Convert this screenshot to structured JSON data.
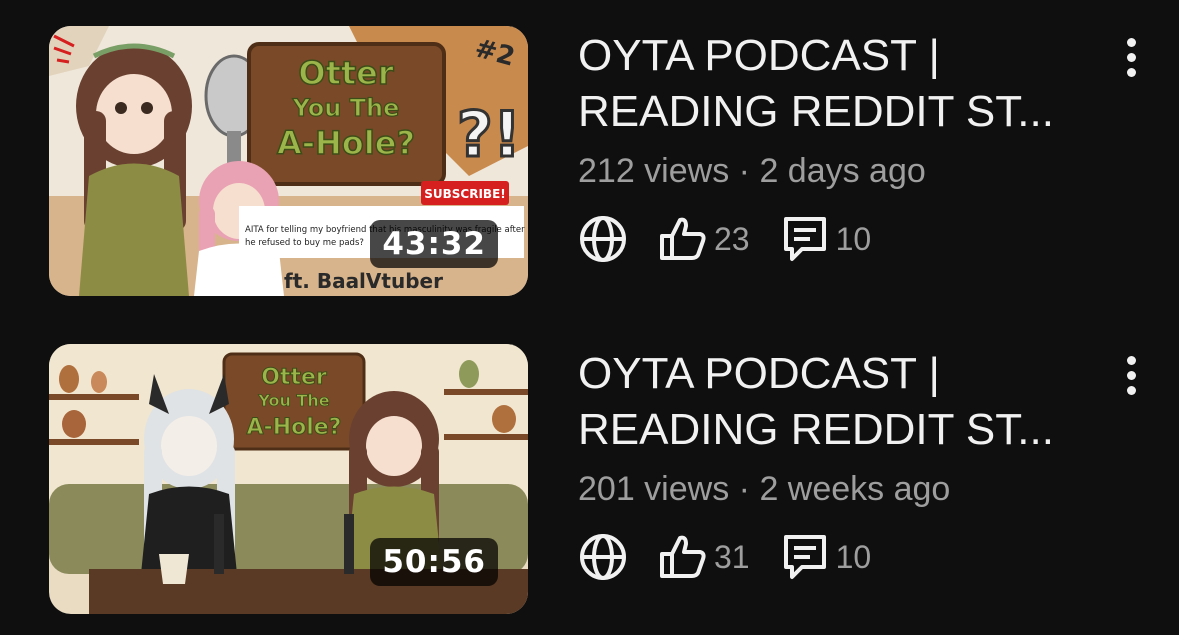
{
  "videos": [
    {
      "title_line1": "OYTA PODCAST |",
      "title_line2": "READING REDDIT ST...",
      "views": "212 views",
      "separator": "·",
      "age": "2 days ago",
      "duration": "43:32",
      "likes": "23",
      "comments": "10",
      "thumbnail": {
        "sign_line1": "Otter",
        "sign_line2": "You The",
        "sign_line3": "A-Hole?",
        "episode": "#2",
        "subscribe": "SUBSCRIBE!",
        "post_text_1": "AITA for telling my boyfriend that his masculinity was fragile after",
        "post_text_2": "he refused to buy me pads?",
        "credit": "ft. BaalVtuber"
      }
    },
    {
      "title_line1": "OYTA PODCAST |",
      "title_line2": "READING REDDIT ST...",
      "views": "201 views",
      "separator": "·",
      "age": "2 weeks ago",
      "duration": "50:56",
      "likes": "31",
      "comments": "10",
      "thumbnail": {
        "sign_line1": "Otter",
        "sign_line2": "You The",
        "sign_line3": "A-Hole?"
      }
    }
  ],
  "icons": {
    "visibility": "globe-icon",
    "likes": "thumbs-up-icon",
    "comments": "comment-icon",
    "menu": "more-vert-icon"
  },
  "colors": {
    "background": "#0f0f0f",
    "primary_text": "#f1f1f1",
    "secondary_text": "#9e9e9e",
    "subscribe_red": "#d62020"
  }
}
